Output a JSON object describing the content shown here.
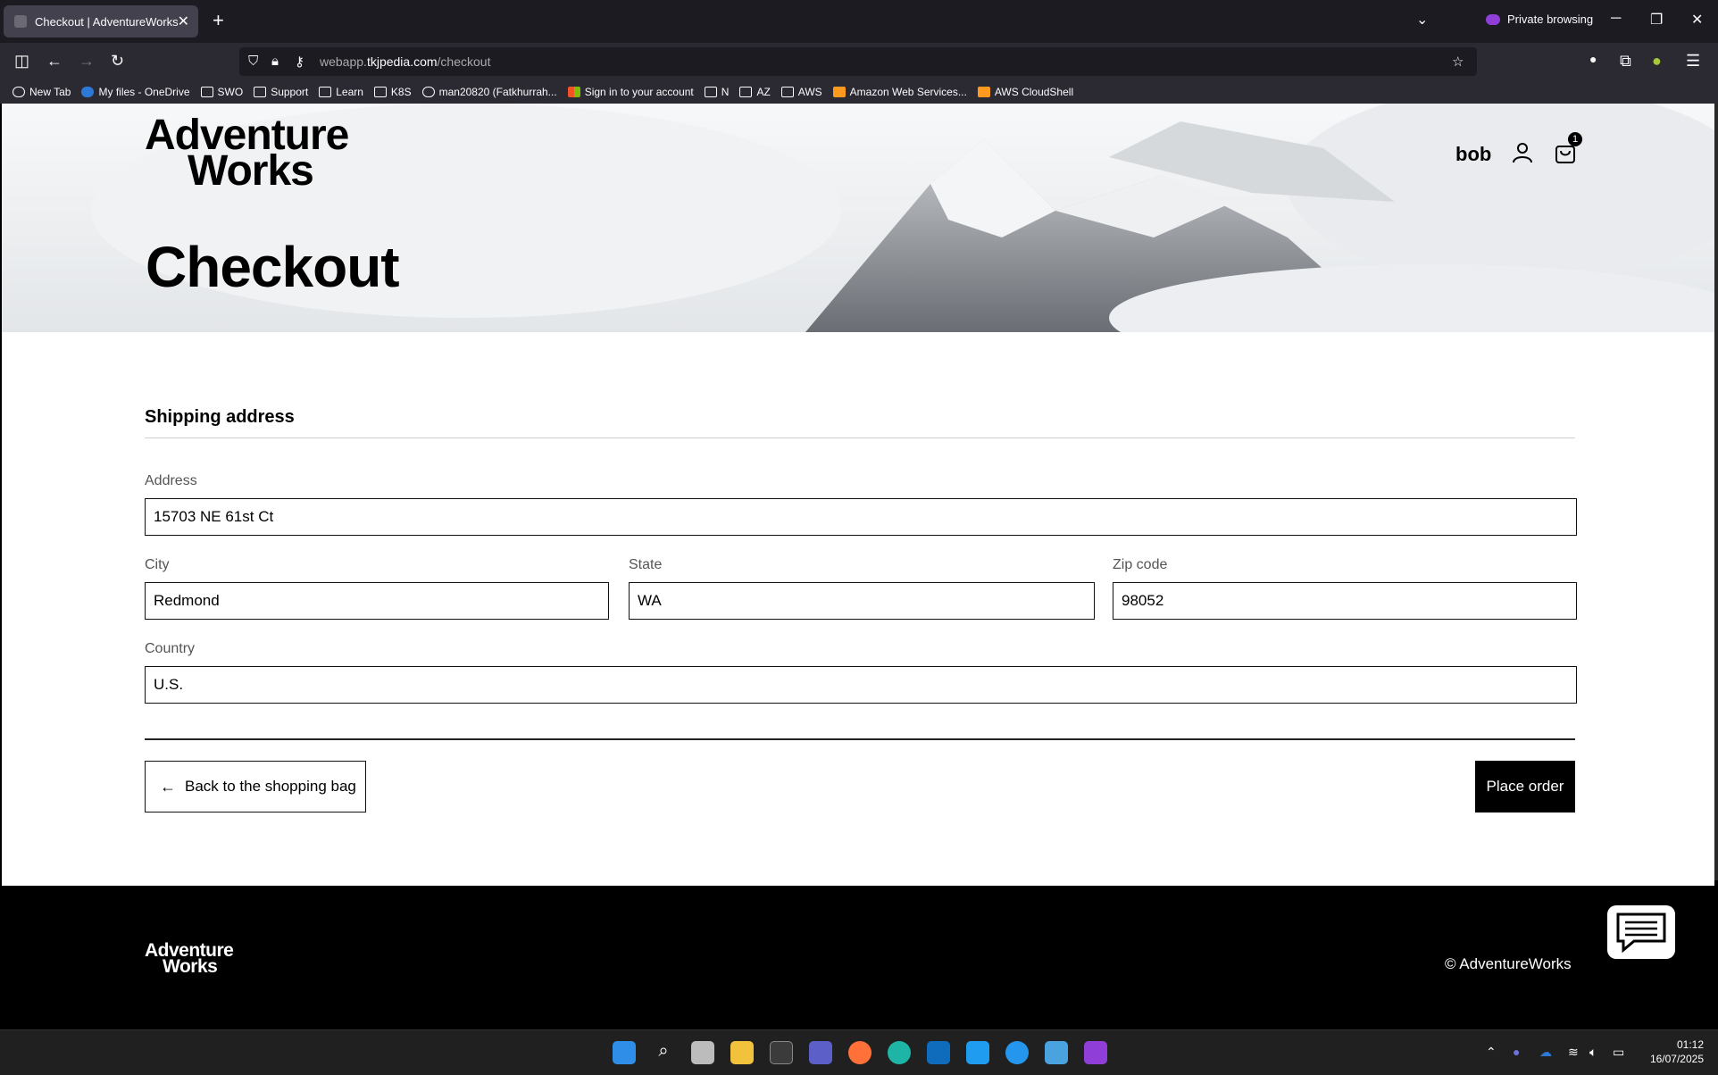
{
  "browser": {
    "tab_title": "Checkout | AdventureWorks",
    "tab_close": "✕",
    "new_tab": "+",
    "tabs_list": "⌄",
    "private_label": "Private browsing",
    "url_host": "webapp.",
    "url_domain": "tkjpedia.com",
    "url_path": "/checkout",
    "bookmarks": [
      "New Tab",
      "My files - OneDrive",
      "SWO",
      "Support",
      "Learn",
      "K8S",
      "man20820 (Fatkhurrah...",
      "Sign in to your account",
      "N",
      "AZ",
      "AWS",
      "Amazon Web Services...",
      "AWS CloudShell"
    ]
  },
  "header": {
    "logo_line1": "Adventure",
    "logo_line2": "Works",
    "page_title": "Checkout",
    "username": "bob",
    "cart_count": "1"
  },
  "form": {
    "section_title": "Shipping address",
    "address_label": "Address",
    "address_value": "15703 NE 61st Ct",
    "city_label": "City",
    "city_value": "Redmond",
    "state_label": "State",
    "state_value": "WA",
    "zip_label": "Zip code",
    "zip_value": "98052",
    "country_label": "Country",
    "country_value": "U.S."
  },
  "actions": {
    "back_arrow": "←",
    "back_label": "Back to the shopping bag",
    "place_order_label": "Place order"
  },
  "footer": {
    "logo_line1": "Adventure",
    "logo_line2": "Works",
    "copyright": "© AdventureWorks"
  },
  "taskbar": {
    "time": "01:12",
    "date": "16/07/2025"
  },
  "colors": {
    "accent": "#000000",
    "browser_dark": "#1c1b22",
    "private_purple": "#8f3fd7"
  }
}
